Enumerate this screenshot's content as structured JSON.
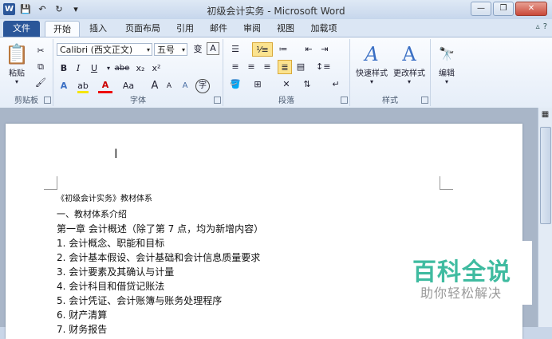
{
  "window": {
    "title": "初级会计实务 - Microsoft Word"
  },
  "quick_access": {
    "icons": [
      "word-logo",
      "save-icon",
      "undo-icon",
      "redo-icon",
      "customize-icon"
    ]
  },
  "tabs": [
    "文件",
    "开始",
    "插入",
    "页面布局",
    "引用",
    "邮件",
    "审阅",
    "视图",
    "加载项"
  ],
  "ribbon": {
    "clipboard": {
      "label": "剪贴板",
      "paste": "粘贴"
    },
    "font": {
      "label": "字体",
      "name": "Calibri (西文正文)",
      "size": "五号",
      "buttons": [
        "B",
        "I",
        "U",
        "abe",
        "x₂",
        "x²",
        "A",
        "A",
        "Aa",
        "A",
        "A",
        "A",
        "字"
      ]
    },
    "paragraph": {
      "label": "段落"
    },
    "styles": {
      "label": "样式",
      "quick_styles": "快速样式",
      "change_styles": "更改样式"
    },
    "editing": {
      "label": "编辑",
      "edit": "编辑"
    }
  },
  "document": {
    "lines": [
      "《初级会计实务》教材体系",
      "一、教材体系介绍",
      "第一章 会计概述（除了第 7 点，均为新增内容）",
      "1.   会计概念、职能和目标",
      "2.   会计基本假设、会计基础和会计信息质量要求",
      "3.   会计要素及其确认与计量",
      "4.   会计科目和借贷记账法",
      "5.   会计凭证、会计账簿与账务处理程序",
      "6.   财产清算",
      "7.   财务报告"
    ]
  },
  "watermark": {
    "title": "百科全说",
    "subtitle": "助你轻松解决"
  }
}
